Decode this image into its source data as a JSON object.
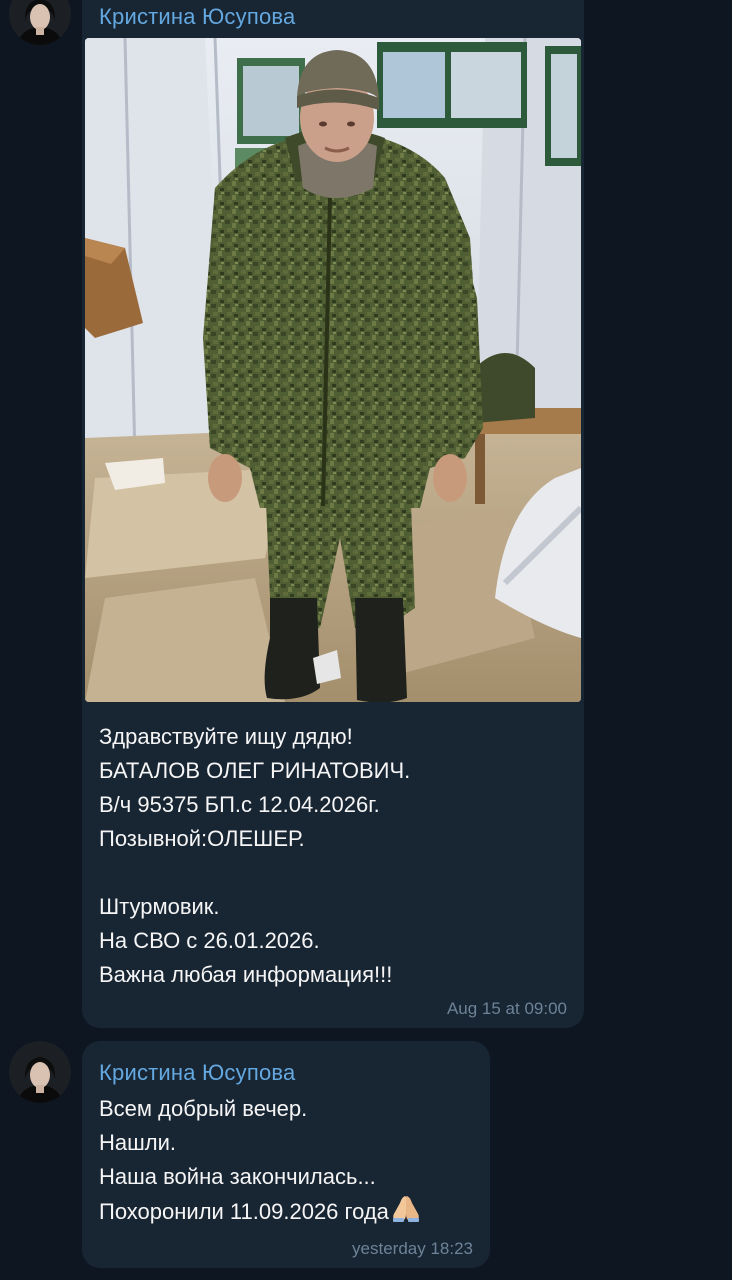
{
  "messages": [
    {
      "sender": "Кристина Юсупова",
      "avatar_icon": "profile-photo-woman",
      "photo": "man-in-camouflage-uniform",
      "lines": [
        "Здравствуйте ищу дядю!",
        "БАТАЛОВ ОЛЕГ РИНАТОВИЧ.",
        "В/ч 95375 БП.с 12.04.2026г.",
        "Позывной:ОЛЕШЕР.",
        "",
        "Штурмовик.",
        "На СВО с 26.01.2026.",
        "Важна любая информация!!!"
      ],
      "time": "Aug 15 at 09:00"
    },
    {
      "sender": "Кристина Юсупова",
      "avatar_icon": "profile-photo-woman",
      "lines": [
        "Всем добрый вечер.",
        "Нашли.",
        "Наша война закончилась...",
        "Похоронили 11.09.2026 года"
      ],
      "emoji": "folded-hands-emoji",
      "time": "yesterday 18:23"
    }
  ],
  "colors": {
    "background": "#0e1621",
    "bubble": "#182533",
    "sender": "#64a8e0",
    "text": "#f5f5f5",
    "time": "#6d8398"
  }
}
